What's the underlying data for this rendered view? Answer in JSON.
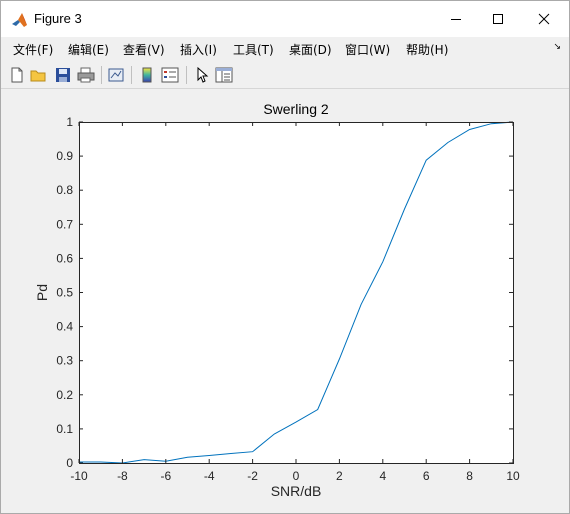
{
  "window": {
    "title": "Figure 3",
    "controls": {
      "minimize": "minimize",
      "maximize": "maximize",
      "close": "close"
    }
  },
  "menubar": {
    "items": [
      {
        "label": "文件(F)"
      },
      {
        "label": "编辑(E)"
      },
      {
        "label": "查看(V)"
      },
      {
        "label": "插入(I)"
      },
      {
        "label": "工具(T)"
      },
      {
        "label": "桌面(D)"
      },
      {
        "label": "窗口(W)"
      },
      {
        "label": "帮助(H)"
      }
    ]
  },
  "toolbar": {
    "buttons": [
      {
        "icon": "new-file-icon"
      },
      {
        "icon": "open-folder-icon"
      },
      {
        "icon": "save-icon"
      },
      {
        "icon": "print-icon"
      },
      {
        "icon": "link-plot-icon"
      },
      {
        "icon": "colorbar-icon"
      },
      {
        "icon": "legend-icon"
      },
      {
        "icon": "pointer-icon"
      },
      {
        "icon": "property-inspector-icon"
      }
    ]
  },
  "chart_data": {
    "type": "line",
    "title": "Swerling 2",
    "xlabel": "SNR/dB",
    "ylabel": "Pd",
    "xlim": [
      -10,
      10
    ],
    "ylim": [
      0,
      1
    ],
    "xticks": [
      "-10",
      "-8",
      "-6",
      "-4",
      "-2",
      "0",
      "2",
      "4",
      "6",
      "8",
      "10"
    ],
    "yticks": [
      "0",
      "0.1",
      "0.2",
      "0.3",
      "0.4",
      "0.5",
      "0.6",
      "0.7",
      "0.8",
      "0.9",
      "1"
    ],
    "grid": false,
    "series": [
      {
        "color": "#0072bd",
        "x": [
          -10,
          -9,
          -8,
          -7,
          -6,
          -5,
          -4,
          -3,
          -2,
          -1,
          0,
          1,
          2,
          3,
          4,
          5,
          6,
          7,
          8,
          9,
          10
        ],
        "y": [
          0.003,
          0.003,
          0.0,
          0.01,
          0.005,
          0.017,
          0.022,
          0.028,
          0.033,
          0.085,
          0.12,
          0.157,
          0.305,
          0.465,
          0.59,
          0.745,
          0.888,
          0.94,
          0.978,
          0.995,
          1.0
        ]
      }
    ]
  }
}
